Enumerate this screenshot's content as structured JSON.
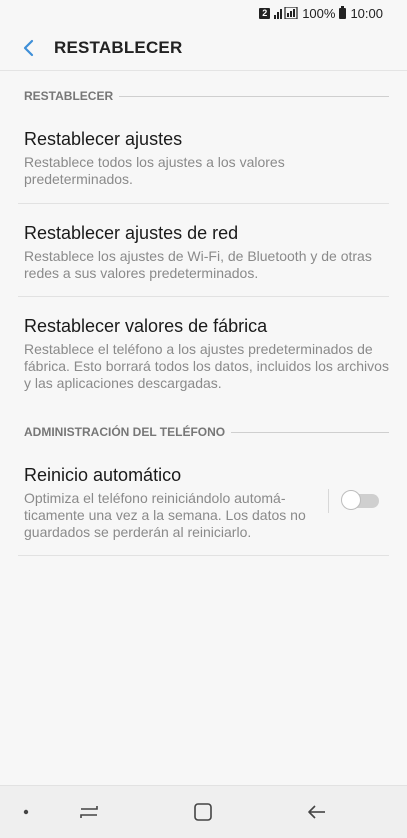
{
  "status_bar": {
    "sim": "2",
    "battery": "100%",
    "time": "10:00"
  },
  "app_bar": {
    "title": "RESTABLECER"
  },
  "sections": {
    "reset": {
      "header": "RESTABLECER",
      "items": [
        {
          "title": "Restablecer ajustes",
          "desc": "Restablece todos los ajustes a los valores predeterminados."
        },
        {
          "title": "Restablecer ajustes de red",
          "desc": "Restablece los ajustes de Wi-Fi, de Bluetooth y de otras redes a sus valores predeterminados."
        },
        {
          "title": "Restablecer valores de fábrica",
          "desc": "Restablece el teléfono a los ajustes predeterminados de fábrica. Esto borrará todos los datos, incluidos los archivos y las aplicaciones descargadas."
        }
      ]
    },
    "admin": {
      "header": "ADMINISTRACIÓN DEL TELÉFONO",
      "auto_restart": {
        "title": "Reinicio automático",
        "desc": "Optimiza el teléfono reiniciándolo automá-ticamente una vez a la semana. Los datos no guardados se perderán al reiniciarlo.",
        "enabled": false
      }
    }
  },
  "colors": {
    "background": "#f7f7f7",
    "accent": "#3e8fd8",
    "secondary_text": "#8a8a8a",
    "header_text": "#777777"
  }
}
